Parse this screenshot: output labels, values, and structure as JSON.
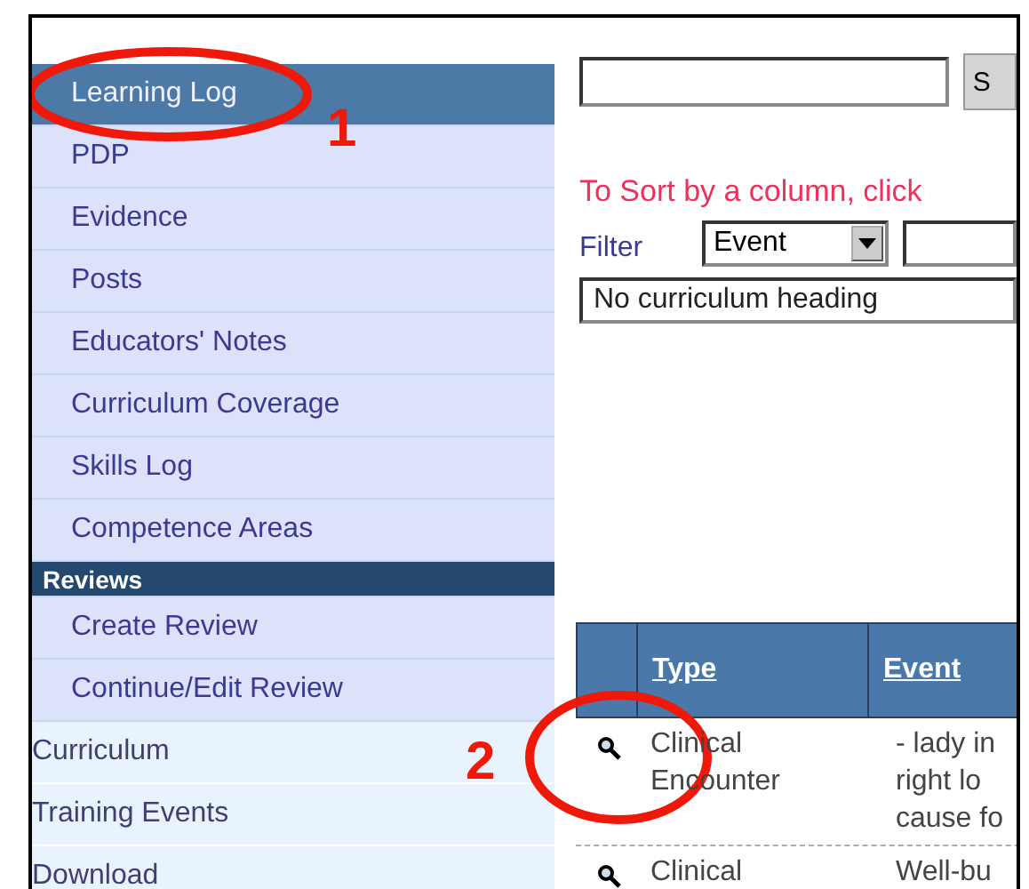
{
  "sidebar": {
    "items": [
      {
        "label": "Learning Log",
        "kind": "item",
        "selected": true
      },
      {
        "label": "PDP",
        "kind": "item",
        "selected": false
      },
      {
        "label": "Evidence",
        "kind": "item",
        "selected": false
      },
      {
        "label": "Posts",
        "kind": "item",
        "selected": false
      },
      {
        "label": "Educators' Notes",
        "kind": "item",
        "selected": false
      },
      {
        "label": "Curriculum Coverage",
        "kind": "item",
        "selected": false
      },
      {
        "label": "Skills Log",
        "kind": "item",
        "selected": false
      },
      {
        "label": "Competence Areas",
        "kind": "item",
        "selected": false
      },
      {
        "label": "Reviews",
        "kind": "header",
        "selected": false
      },
      {
        "label": "Create Review",
        "kind": "item",
        "selected": false
      },
      {
        "label": "Continue/Edit Review",
        "kind": "item",
        "selected": false
      },
      {
        "label": "Curriculum",
        "kind": "top",
        "selected": false
      },
      {
        "label": "Training Events",
        "kind": "top",
        "selected": false
      },
      {
        "label": "Download",
        "kind": "top",
        "selected": false
      }
    ]
  },
  "search": {
    "button": "S"
  },
  "sort_hint": "To Sort by a column, click",
  "filter": {
    "label": "Filter",
    "select": "Event"
  },
  "curriculum_select": "No curriculum heading",
  "table": {
    "columns": [
      "Type",
      "Event"
    ],
    "rows": [
      {
        "type": [
          "Clinical",
          "Encounter"
        ],
        "event": [
          "- lady in",
          "right lo",
          "cause fo"
        ]
      },
      {
        "type": [
          "Clinical"
        ],
        "event": [
          "Well-bu"
        ]
      }
    ]
  },
  "annotations": [
    {
      "number": "1"
    },
    {
      "number": "2"
    }
  ]
}
